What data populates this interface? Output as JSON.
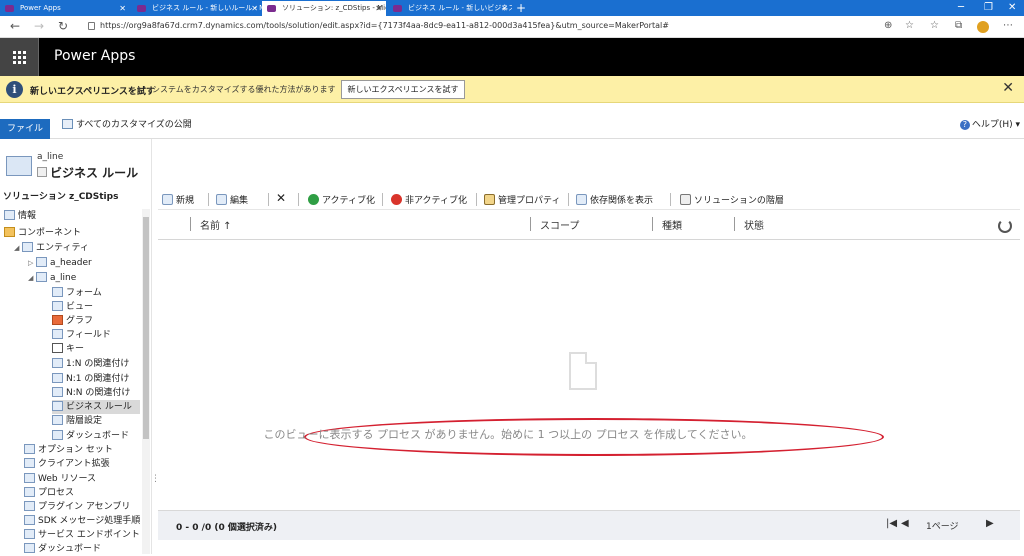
{
  "browser": {
    "tabs": [
      {
        "label": "Power Apps"
      },
      {
        "label": "ビジネス ルール - 新しいルール - Micr..."
      },
      {
        "label": "ソリューション: z_CDStips - Microso..."
      },
      {
        "label": "ビジネス ルール - 新しいビジネス ル..."
      }
    ],
    "url": "https://org9a8fa67d.crm7.dynamics.com/tools/solution/edit.aspx?id={7173f4aa-8dc9-ea11-a812-000d3a415fea}&utm_source=MakerPortal#"
  },
  "app": {
    "title": "Power Apps"
  },
  "banner": {
    "title": "新しいエクスペリエンスを試す",
    "message": "システムをカスタマイズする優れた方法があります",
    "button": "新しいエクスペリエンスを試す",
    "close": "✕"
  },
  "ribbon": {
    "file_tab": "ファイル",
    "publish_all": "すべてのカスタマイズの公開",
    "help": "ヘルプ(H)"
  },
  "entity": {
    "name": "a_line",
    "section": "ビジネス ルール"
  },
  "solution": {
    "label": "ソリューション z_CDStips"
  },
  "tree": [
    {
      "label": "情報"
    },
    {
      "label": "コンポーネント"
    },
    {
      "label": "エンティティ"
    },
    {
      "label": "a_header"
    },
    {
      "label": "a_line"
    },
    {
      "label": "フォーム"
    },
    {
      "label": "ビュー"
    },
    {
      "label": "グラフ"
    },
    {
      "label": "フィールド"
    },
    {
      "label": "キー"
    },
    {
      "label": "1:N の関連付け"
    },
    {
      "label": "N:1 の関連付け"
    },
    {
      "label": "N:N の関連付け"
    },
    {
      "label": "ビジネス ルール"
    },
    {
      "label": "階層設定"
    },
    {
      "label": "ダッシュボード"
    },
    {
      "label": "オプション セット"
    },
    {
      "label": "クライアント拡張"
    },
    {
      "label": "Web リソース"
    },
    {
      "label": "プロセス"
    },
    {
      "label": "プラグイン アセンブリ"
    },
    {
      "label": "SDK メッセージ処理手順"
    },
    {
      "label": "サービス エンドポイント"
    },
    {
      "label": "ダッシュボード"
    }
  ],
  "toolbar": {
    "new": "新規",
    "edit": "編集",
    "delete": "✕",
    "activate": "アクティブ化",
    "deactivate": "非アクティブ化",
    "managed_props": "管理プロパティ",
    "show_deps": "依存関係を表示",
    "layers": "ソリューションの階層"
  },
  "columns": {
    "name": "名前 ↑",
    "scope": "スコープ",
    "type": "種類",
    "status": "状態"
  },
  "empty_message": "このビューに表示する プロセス がありません。始めに 1 つ以上の プロセス を作成してください。",
  "footer": {
    "count": "0 - 0 /0 (0 個選択済み)",
    "page": "1ページ"
  },
  "colors": {
    "accent": "#1d6bbf",
    "banner": "#fdf0a6",
    "highlight": "#d42030"
  }
}
